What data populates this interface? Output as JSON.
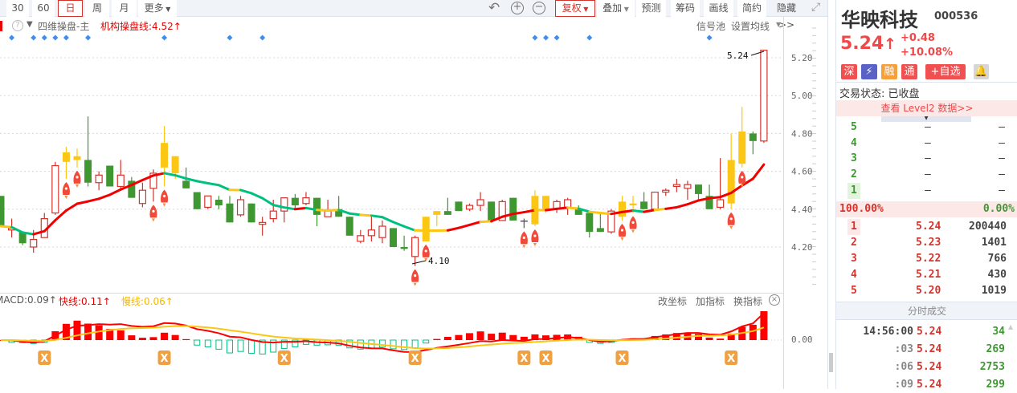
{
  "toolbar": {
    "periods": [
      "30",
      "60",
      "日",
      "周",
      "月"
    ],
    "more": "更多",
    "fuquan": "复权",
    "diejia": "叠加",
    "yuce": "预测",
    "chouma": "筹码",
    "huaxian": "画线",
    "jianyue": "简约",
    "yincang": "隐藏>>"
  },
  "main": {
    "indicator_name": "四维操盘-主",
    "line_label": "机构操盘线:4.52↑",
    "signal_pool": "信号池",
    "ma_setting": "设置均线",
    "high_label": "5.24",
    "low_label": "4.10"
  },
  "macd": {
    "macd": "MACD:0.09↑",
    "fast": "快线:0.11↑",
    "slow": "慢线:0.06↑",
    "change_axis": "改坐标",
    "add_ind": "加指标",
    "switch_ind": "换指标",
    "zero": "0.00"
  },
  "colors": {
    "up": "#d4332c",
    "down": "#3f9732",
    "limit": "#fcc614",
    "ma_up": "#f20000",
    "ma_flat": "#fcc614",
    "ma_down": "#00c080",
    "diamond": "#3d8ef0"
  },
  "chart_data": {
    "type": "candlestick",
    "y_ticks": [
      "5.20",
      "5.00",
      "4.80",
      "4.60",
      "4.40",
      "4.20"
    ],
    "ylim": [
      4.05,
      5.27
    ],
    "candles": [
      [
        4.47,
        4.47,
        4.31,
        4.31,
        "d"
      ],
      [
        4.29,
        4.35,
        4.25,
        4.3,
        "u"
      ],
      [
        4.28,
        4.28,
        4.21,
        4.22,
        "d"
      ],
      [
        4.2,
        4.29,
        4.17,
        4.24,
        "u"
      ],
      [
        4.25,
        4.38,
        4.25,
        4.35,
        "u"
      ],
      [
        4.38,
        4.65,
        4.37,
        4.63,
        "u"
      ],
      [
        4.65,
        4.73,
        4.56,
        4.7,
        "y"
      ],
      [
        4.66,
        4.72,
        4.62,
        4.68,
        "y"
      ],
      [
        4.66,
        4.89,
        4.52,
        4.54,
        "d"
      ],
      [
        4.54,
        4.6,
        4.5,
        4.58,
        "u"
      ],
      [
        4.63,
        4.63,
        4.52,
        4.52,
        "d"
      ],
      [
        4.52,
        4.66,
        4.51,
        4.58,
        "u"
      ],
      [
        4.55,
        4.57,
        4.46,
        4.46,
        "d"
      ],
      [
        4.43,
        4.54,
        4.41,
        4.5,
        "u"
      ],
      [
        4.51,
        4.61,
        4.44,
        4.59,
        "u"
      ],
      [
        4.62,
        4.84,
        4.52,
        4.75,
        "y"
      ],
      [
        4.68,
        4.68,
        4.56,
        4.59,
        "y"
      ],
      [
        4.55,
        4.62,
        4.51,
        4.51,
        "d"
      ],
      [
        4.49,
        4.49,
        4.4,
        4.4,
        "d"
      ],
      [
        4.41,
        4.47,
        4.4,
        4.47,
        "u"
      ],
      [
        4.45,
        4.47,
        4.4,
        4.42,
        "d"
      ],
      [
        4.43,
        4.47,
        4.33,
        4.33,
        "d"
      ],
      [
        4.37,
        4.47,
        4.36,
        4.45,
        "u"
      ],
      [
        4.43,
        4.43,
        4.33,
        4.33,
        "d"
      ],
      [
        4.32,
        4.36,
        4.26,
        4.33,
        "u"
      ],
      [
        4.35,
        4.45,
        4.33,
        4.39,
        "u"
      ],
      [
        4.39,
        4.46,
        4.33,
        4.46,
        "u"
      ],
      [
        4.46,
        4.48,
        4.4,
        4.42,
        "d"
      ],
      [
        4.43,
        4.49,
        4.42,
        4.46,
        "u"
      ],
      [
        4.46,
        4.46,
        4.31,
        4.37,
        "d"
      ],
      [
        4.36,
        4.45,
        4.36,
        4.39,
        "u"
      ],
      [
        4.4,
        4.47,
        4.36,
        4.36,
        "d"
      ],
      [
        4.36,
        4.36,
        4.26,
        4.26,
        "d"
      ],
      [
        4.23,
        4.29,
        4.22,
        4.26,
        "u"
      ],
      [
        4.26,
        4.36,
        4.23,
        4.29,
        "u"
      ],
      [
        4.25,
        4.34,
        4.22,
        4.31,
        "u"
      ],
      [
        4.3,
        4.3,
        4.2,
        4.2,
        "d"
      ],
      [
        4.2,
        4.26,
        4.18,
        4.19,
        "d"
      ],
      [
        4.15,
        4.26,
        4.1,
        4.25,
        "u"
      ],
      [
        4.23,
        4.36,
        4.23,
        4.36,
        "y"
      ],
      [
        4.37,
        4.39,
        4.31,
        4.39,
        "y"
      ],
      [
        4.39,
        4.46,
        4.37,
        4.37,
        "d"
      ],
      [
        4.44,
        4.44,
        4.39,
        4.39,
        "d"
      ],
      [
        4.4,
        4.43,
        4.39,
        4.42,
        "u"
      ],
      [
        4.42,
        4.49,
        4.39,
        4.45,
        "u"
      ],
      [
        4.44,
        4.44,
        4.34,
        4.34,
        "d"
      ],
      [
        4.34,
        4.45,
        4.34,
        4.44,
        "u"
      ],
      [
        4.46,
        4.46,
        4.34,
        4.34,
        "d"
      ],
      [
        4.34,
        4.35,
        4.3,
        4.34,
        "n"
      ],
      [
        4.32,
        4.5,
        4.31,
        4.47,
        "y"
      ],
      [
        4.47,
        4.47,
        4.38,
        4.39,
        "y"
      ],
      [
        4.4,
        4.45,
        4.38,
        4.44,
        "u"
      ],
      [
        4.41,
        4.46,
        4.37,
        4.45,
        "u"
      ],
      [
        4.4,
        4.42,
        4.37,
        4.37,
        "d"
      ],
      [
        4.38,
        4.38,
        4.25,
        4.28,
        "d"
      ],
      [
        4.3,
        4.38,
        4.28,
        4.28,
        "d"
      ],
      [
        4.28,
        4.4,
        4.27,
        4.39,
        "u"
      ],
      [
        4.36,
        4.47,
        4.34,
        4.44,
        "y"
      ],
      [
        4.43,
        4.47,
        4.38,
        4.42,
        "y"
      ],
      [
        4.44,
        4.49,
        4.4,
        4.4,
        "d"
      ],
      [
        4.4,
        4.49,
        4.4,
        4.49,
        "u"
      ],
      [
        4.49,
        4.51,
        4.47,
        4.5,
        "u"
      ],
      [
        4.52,
        4.56,
        4.49,
        4.53,
        "u"
      ],
      [
        4.51,
        4.55,
        4.45,
        4.53,
        "u"
      ],
      [
        4.53,
        4.53,
        4.45,
        4.48,
        "d"
      ],
      [
        4.47,
        4.53,
        4.4,
        4.4,
        "d"
      ],
      [
        4.41,
        4.67,
        4.4,
        4.45,
        "u"
      ],
      [
        4.43,
        4.8,
        4.4,
        4.66,
        "y"
      ],
      [
        4.64,
        4.94,
        4.62,
        4.81,
        "y"
      ],
      [
        4.8,
        4.81,
        4.69,
        4.76,
        "d"
      ],
      [
        4.76,
        5.24,
        4.75,
        5.24,
        "u"
      ]
    ],
    "diamond_signals": [
      1,
      3,
      4,
      5,
      6,
      8,
      15,
      21,
      24,
      49,
      50,
      51,
      54,
      65
    ],
    "rocket_signals": [
      6,
      7,
      14,
      15,
      38,
      39,
      48,
      49,
      57,
      58,
      67,
      68
    ],
    "x_signals": [
      4,
      15,
      26,
      38,
      48,
      50,
      57,
      67
    ]
  },
  "quote": {
    "name": "华映科技",
    "code": "000536",
    "price": "5.24",
    "arrow": "↑",
    "change": "+0.48",
    "pct": "+10.08%",
    "badges": [
      "深",
      "融",
      "通"
    ],
    "add_watch": "+自选",
    "status": "交易状态: 已收盘",
    "level2": "查看 Level2 数据>>",
    "sells": [
      {
        "lv": "5",
        "p": "—",
        "v": "—"
      },
      {
        "lv": "4",
        "p": "—",
        "v": "—"
      },
      {
        "lv": "3",
        "p": "—",
        "v": "—"
      },
      {
        "lv": "2",
        "p": "—",
        "v": "—"
      },
      {
        "lv": "1",
        "p": "—",
        "v": "—"
      }
    ],
    "ratio_buy": "100.00%",
    "ratio_sell": "0.00%",
    "buys": [
      {
        "lv": "1",
        "p": "5.24",
        "v": "200440"
      },
      {
        "lv": "2",
        "p": "5.23",
        "v": "1401"
      },
      {
        "lv": "3",
        "p": "5.22",
        "v": "766"
      },
      {
        "lv": "4",
        "p": "5.21",
        "v": "430"
      },
      {
        "lv": "5",
        "p": "5.20",
        "v": "1019"
      }
    ],
    "trades_title": "分时成交",
    "trades": [
      {
        "t": "14:56:00",
        "p": "5.24",
        "v": "34"
      },
      {
        "t": ":03",
        "p": "5.24",
        "v": "269"
      },
      {
        "t": ":06",
        "p": "5.24",
        "v": "2753"
      },
      {
        "t": ":09",
        "p": "5.24",
        "v": "299"
      }
    ]
  }
}
